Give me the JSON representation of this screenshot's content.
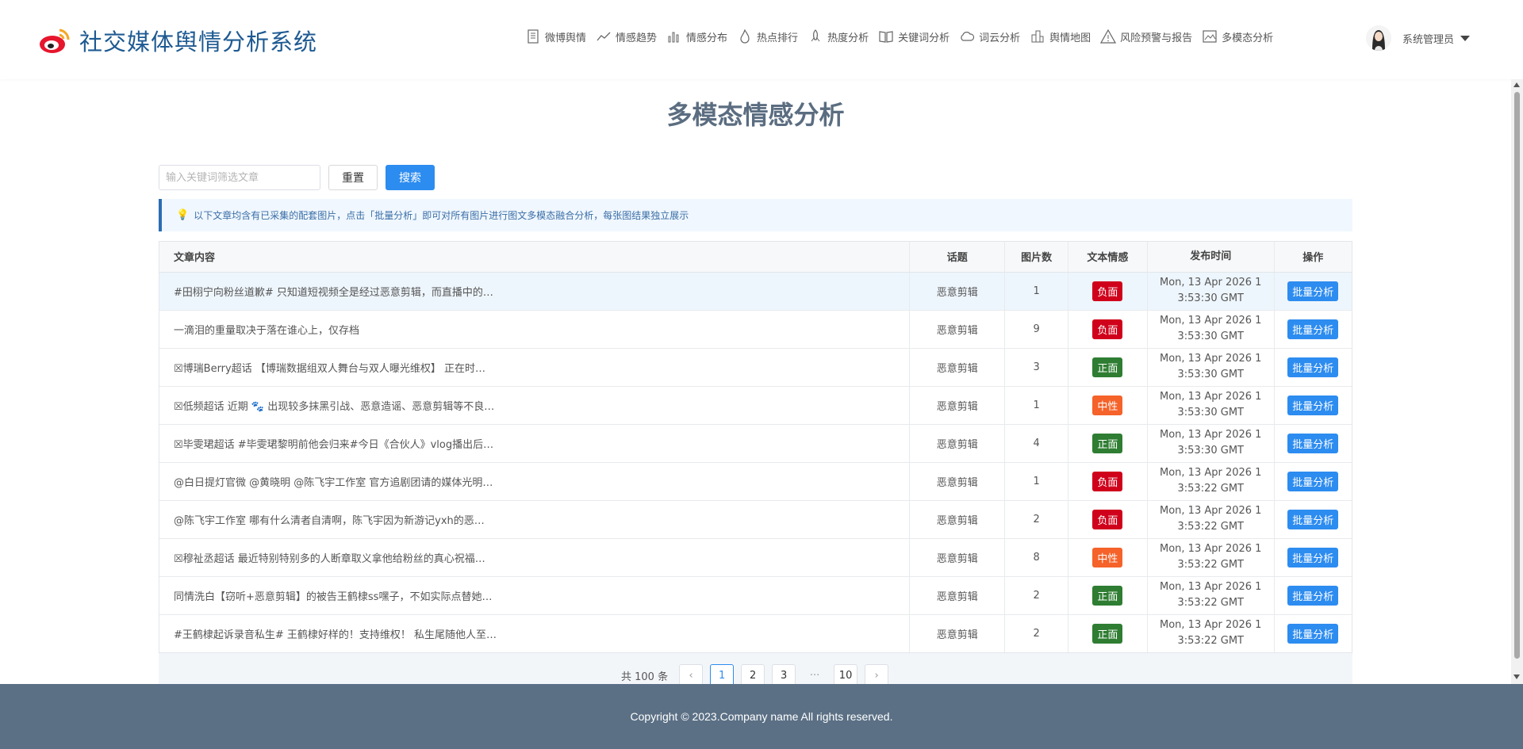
{
  "app": {
    "title": "社交媒体舆情分析系统"
  },
  "nav": [
    {
      "label": "微博舆情",
      "icon": "document-icon"
    },
    {
      "label": "情感趋势",
      "icon": "trend-line-icon"
    },
    {
      "label": "情感分布",
      "icon": "bar-chart-icon"
    },
    {
      "label": "热点排行",
      "icon": "flame-icon"
    },
    {
      "label": "热度分析",
      "icon": "rocket-icon"
    },
    {
      "label": "关键词分析",
      "icon": "book-icon"
    },
    {
      "label": "词云分析",
      "icon": "cloud-icon"
    },
    {
      "label": "舆情地图",
      "icon": "building-icon"
    },
    {
      "label": "风险预警与报告",
      "icon": "warning-icon"
    },
    {
      "label": "多模态分析",
      "icon": "image-icon"
    }
  ],
  "user": {
    "name": "系统管理员"
  },
  "page": {
    "title": "多模态情感分析"
  },
  "search": {
    "placeholder": "输入关键词筛选文章",
    "value": "",
    "reset_label": "重置",
    "search_label": "搜索"
  },
  "tip": {
    "text": "以下文章均含有已采集的配套图片，点击「批量分析」即可对所有图片进行图文多模态融合分析，每张图结果独立展示"
  },
  "table": {
    "headers": [
      "文章内容",
      "话题",
      "图片数",
      "文本情感",
      "发布时间",
      "操作"
    ],
    "rows": [
      {
        "content": "#田栩宁向粉丝道歉# 只知道短视频全是经过恶意剪辑，而直播中的…",
        "topic": "恶意剪辑",
        "count": "1",
        "sentiment": "负面",
        "sentiment_type": "neg",
        "time1": "Mon, 13 Apr 2026 1",
        "time2": "3:53:30 GMT",
        "op": "批量分析"
      },
      {
        "content": "一滴泪的重量取决于落在谁心上，仅存档",
        "topic": "恶意剪辑",
        "count": "9",
        "sentiment": "负面",
        "sentiment_type": "neg",
        "time1": "Mon, 13 Apr 2026 1",
        "time2": "3:53:30 GMT",
        "op": "批量分析"
      },
      {
        "content": "☒博瑞Berry超话 【博瑞数据组双人舞台与双人曝光维权】 正在时…",
        "topic": "恶意剪辑",
        "count": "3",
        "sentiment": "正面",
        "sentiment_type": "pos",
        "time1": "Mon, 13 Apr 2026 1",
        "time2": "3:53:30 GMT",
        "op": "批量分析"
      },
      {
        "content": "☒低频超话 近期 🐾 出现较多抹黑引战、恶意造谣、恶意剪辑等不良…",
        "topic": "恶意剪辑",
        "count": "1",
        "sentiment": "中性",
        "sentiment_type": "neu",
        "time1": "Mon, 13 Apr 2026 1",
        "time2": "3:53:30 GMT",
        "op": "批量分析"
      },
      {
        "content": "☒毕雯珺超话 #毕雯珺黎明前他会归来#今日《合伙人》vlog播出后…",
        "topic": "恶意剪辑",
        "count": "4",
        "sentiment": "正面",
        "sentiment_type": "pos",
        "time1": "Mon, 13 Apr 2026 1",
        "time2": "3:53:30 GMT",
        "op": "批量分析"
      },
      {
        "content": "@白日提灯官微 @黄晓明 @陈飞宇工作室 官方追剧团请的媒体光明…",
        "topic": "恶意剪辑",
        "count": "1",
        "sentiment": "负面",
        "sentiment_type": "neg",
        "time1": "Mon, 13 Apr 2026 1",
        "time2": "3:53:22 GMT",
        "op": "批量分析"
      },
      {
        "content": "@陈飞宇工作室 哪有什么清者自清啊，陈飞宇因为新游记yxh的恶…",
        "topic": "恶意剪辑",
        "count": "2",
        "sentiment": "负面",
        "sentiment_type": "neg",
        "time1": "Mon, 13 Apr 2026 1",
        "time2": "3:53:22 GMT",
        "op": "批量分析"
      },
      {
        "content": "☒穆祉丞超话 最近特别特别多的人断章取义拿他给粉丝的真心祝福…",
        "topic": "恶意剪辑",
        "count": "8",
        "sentiment": "中性",
        "sentiment_type": "neu",
        "time1": "Mon, 13 Apr 2026 1",
        "time2": "3:53:22 GMT",
        "op": "批量分析"
      },
      {
        "content": "同情洗白【窃听+恶意剪辑】的被告王鹤棣ss嘿子，不如实际点替她…",
        "topic": "恶意剪辑",
        "count": "2",
        "sentiment": "正面",
        "sentiment_type": "pos",
        "time1": "Mon, 13 Apr 2026 1",
        "time2": "3:53:22 GMT",
        "op": "批量分析"
      },
      {
        "content": "#王鹤棣起诉录音私生# 王鹤棣好样的！支持维权！ 私生尾随他人至…",
        "topic": "恶意剪辑",
        "count": "2",
        "sentiment": "正面",
        "sentiment_type": "pos",
        "time1": "Mon, 13 Apr 2026 1",
        "time2": "3:53:22 GMT",
        "op": "批量分析"
      }
    ]
  },
  "pagination": {
    "total": "共 100 条",
    "pages": [
      "1",
      "2",
      "3"
    ],
    "ellipsis": "···",
    "last": "10",
    "current": "1",
    "prev": "‹",
    "next": "›"
  },
  "footer": {
    "text": "Copyright © 2023.Company name All rights reserved."
  },
  "colors": {
    "brand": "#1e5a92",
    "primary_button": "#2d8cf0",
    "negative": "#d0021b",
    "positive": "#2e7d32",
    "neutral": "#f5622a",
    "footer": "#5b7085"
  }
}
